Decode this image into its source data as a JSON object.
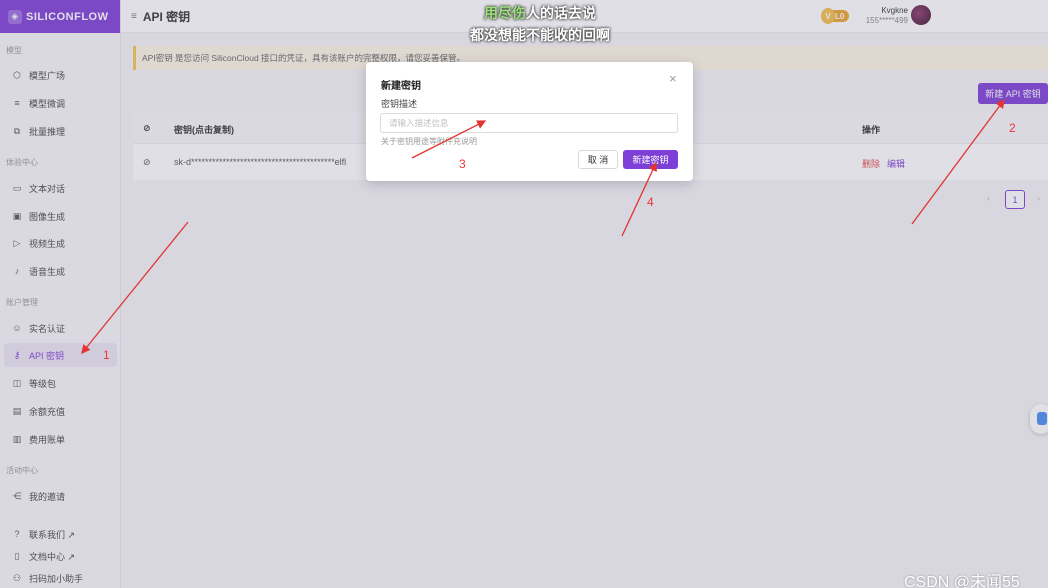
{
  "logo": {
    "text": "SILICONFLOW"
  },
  "header": {
    "title": "API 密钥",
    "level": "L0",
    "user_name": "Kvgkne",
    "user_phone": "155*****499"
  },
  "sidebar": {
    "sections": [
      "模型",
      "体验中心",
      "账户管理",
      "活动中心"
    ],
    "items": [
      {
        "label": "模型广场",
        "icon": "cube-icon"
      },
      {
        "label": "模型微调",
        "icon": "tune-icon"
      },
      {
        "label": "批量推理",
        "icon": "batch-icon"
      },
      {
        "label": "文本对话",
        "icon": "chat-icon"
      },
      {
        "label": "图像生成",
        "icon": "image-icon"
      },
      {
        "label": "视频生成",
        "icon": "video-icon"
      },
      {
        "label": "语音生成",
        "icon": "mic-icon"
      },
      {
        "label": "实名认证",
        "icon": "user-check-icon"
      },
      {
        "label": "API 密钥",
        "icon": "key-icon"
      },
      {
        "label": "等级包",
        "icon": "package-icon"
      },
      {
        "label": "余额充值",
        "icon": "wallet-icon"
      },
      {
        "label": "费用账单",
        "icon": "bill-icon"
      },
      {
        "label": "我的邀请",
        "icon": "share-icon"
      }
    ],
    "footer": [
      "联系我们 ↗",
      "文档中心 ↗",
      "扫码加小助手"
    ]
  },
  "notice": "API密钥 是您访问 SiliconCloud 接口的凭证，具有该账户的完整权限，请您妥善保管。",
  "main": {
    "new_key_button": "新建 API 密钥",
    "table": {
      "col_key": "密钥(点击复制)",
      "col_action": "操作",
      "rows": [
        {
          "key": "sk-d*****************************************elfl",
          "delete": "删除",
          "edit": "编辑"
        }
      ]
    },
    "pager": {
      "prev": "‹",
      "page": "1",
      "next": "›"
    }
  },
  "dialog": {
    "title": "新建密钥",
    "close": "×",
    "label": "密钥描述",
    "placeholder": "请输入描述信息",
    "hint": "关于密钥用途等附件充说明",
    "cancel": "取 消",
    "ok": "新建密钥"
  },
  "caption": {
    "line1_highlight": "用尽伤",
    "line1_rest": "人的话去说",
    "line2": "都没想能不能收的回啊"
  },
  "annotations": [
    "1",
    "2",
    "3",
    "4"
  ],
  "watermark": "CSDN @未闻55",
  "colors": {
    "accent": "#7d3fd6",
    "arrow": "#e33333",
    "notice_bg": "#fbf7e4"
  }
}
